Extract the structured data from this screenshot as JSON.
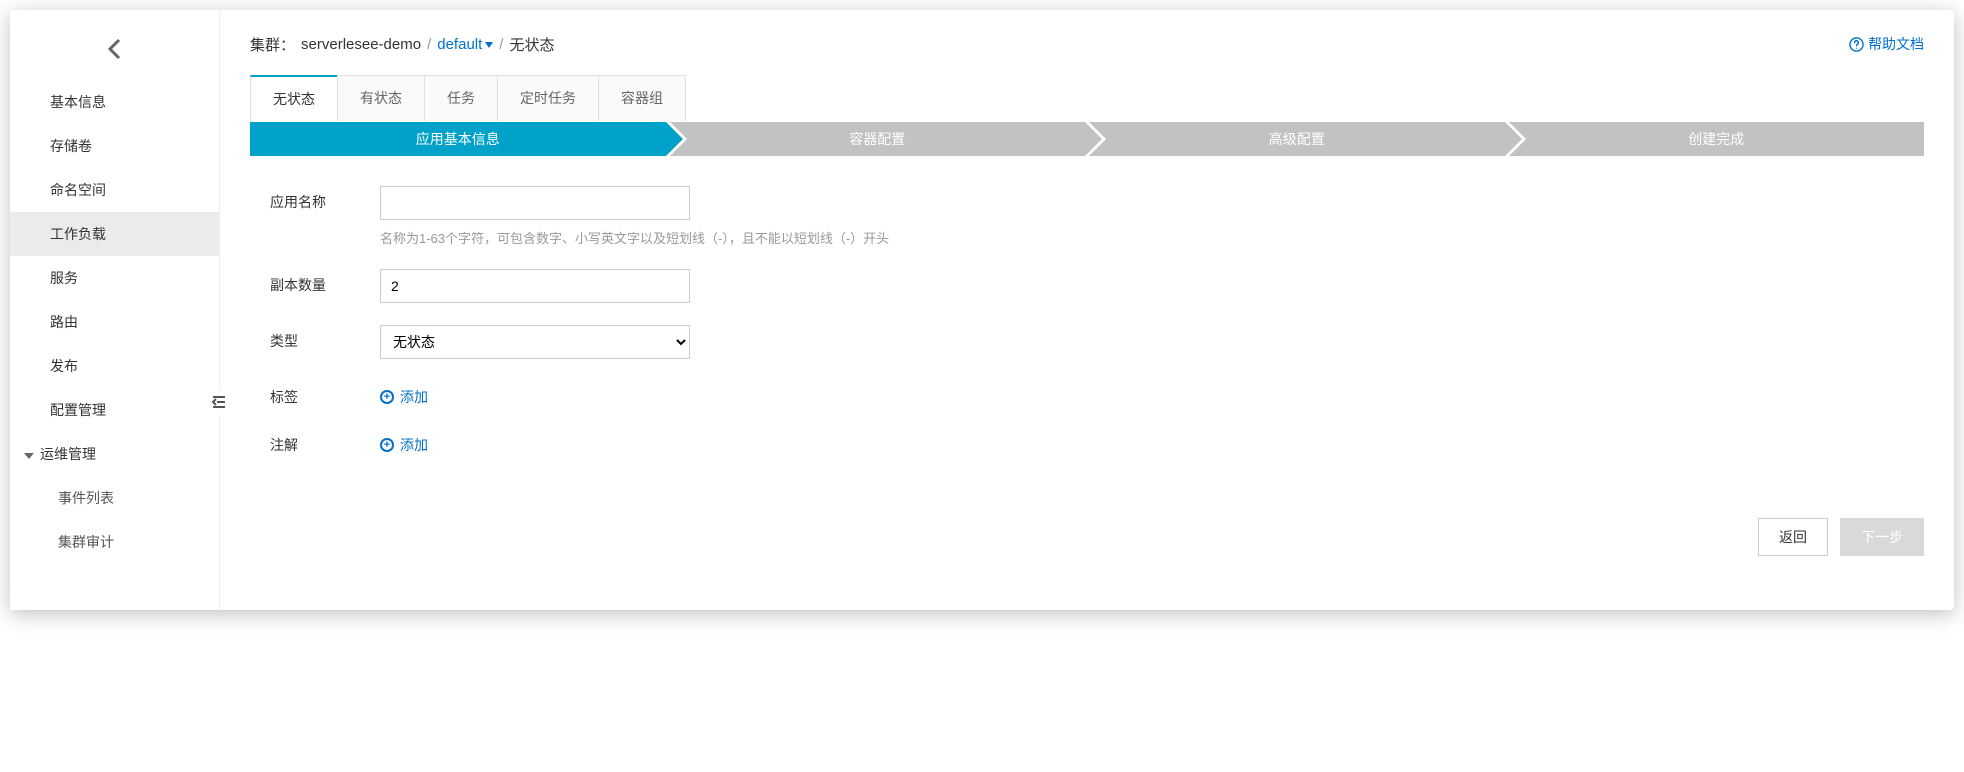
{
  "sidebar": {
    "items": [
      {
        "label": "基本信息"
      },
      {
        "label": "存储卷"
      },
      {
        "label": "命名空间"
      },
      {
        "label": "工作负载"
      },
      {
        "label": "服务"
      },
      {
        "label": "路由"
      },
      {
        "label": "发布"
      },
      {
        "label": "配置管理"
      },
      {
        "label": "运维管理"
      },
      {
        "label": "事件列表"
      },
      {
        "label": "集群审计"
      }
    ]
  },
  "breadcrumb": {
    "cluster_label": "集群：",
    "cluster_name": "serverlesee-demo",
    "namespace": "default",
    "current": "无状态"
  },
  "help_link": "帮助文档",
  "tabs": [
    {
      "label": "无状态"
    },
    {
      "label": "有状态"
    },
    {
      "label": "任务"
    },
    {
      "label": "定时任务"
    },
    {
      "label": "容器组"
    }
  ],
  "steps": [
    {
      "label": "应用基本信息"
    },
    {
      "label": "容器配置"
    },
    {
      "label": "高级配置"
    },
    {
      "label": "创建完成"
    }
  ],
  "form": {
    "app_name_label": "应用名称",
    "app_name_value": "",
    "app_name_hint": "名称为1-63个字符，可包含数字、小写英文字以及短划线（-），且不能以短划线（-）开头",
    "replicas_label": "副本数量",
    "replicas_value": "2",
    "type_label": "类型",
    "type_value": "无状态",
    "labels_label": "标签",
    "annotations_label": "注解",
    "add_text": "添加"
  },
  "footer": {
    "back": "返回",
    "next": "下一步"
  }
}
